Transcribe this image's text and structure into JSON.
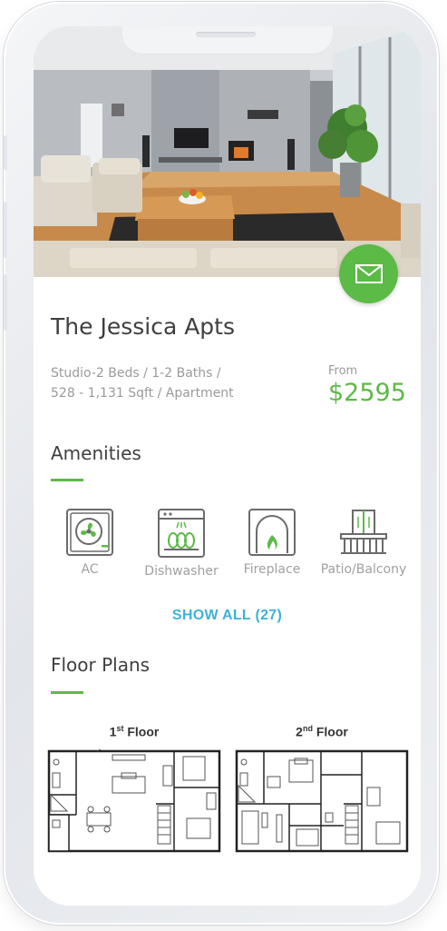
{
  "listing": {
    "name": "The Jessica Apts",
    "details_line1": "Studio-2 Beds / 1-2 Baths /",
    "details_line2": "528 - 1,131 Sqft / Apartment",
    "price_prefix": "From",
    "price": "$2595"
  },
  "amenities": {
    "title": "Amenities",
    "items": [
      {
        "label": "AC",
        "icon": "ac-icon"
      },
      {
        "label": "Dishwasher",
        "icon": "dishwasher-icon"
      },
      {
        "label": "Fireplace",
        "icon": "fireplace-icon"
      },
      {
        "label": "Patio/Balcony",
        "icon": "balcony-icon"
      }
    ],
    "show_all": "SHOW ALL (27)"
  },
  "floor_plans": {
    "title": "Floor Plans",
    "plans": [
      {
        "num": "1",
        "sup": "st",
        "label": " Floor"
      },
      {
        "num": "2",
        "sup": "nd",
        "label": " Floor"
      }
    ]
  },
  "icons": {
    "contact": "mail-icon"
  },
  "colors": {
    "accent": "#5cba47",
    "link": "#3fb1d8",
    "text": "#3f3f3f",
    "muted": "#9a9a9a"
  }
}
